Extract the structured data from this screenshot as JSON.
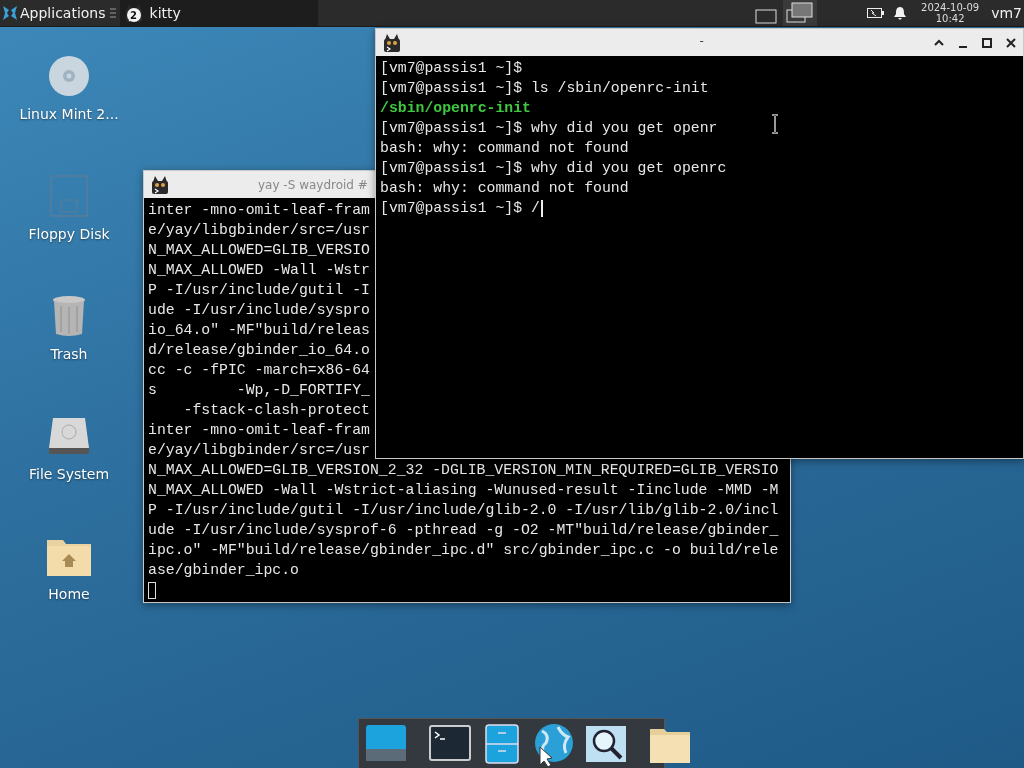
{
  "panel": {
    "menu_label": "Applications",
    "tasks": [
      {
        "label": "kitty",
        "count": "2",
        "selected": true
      }
    ],
    "workspaces": [
      {
        "selected": false
      },
      {
        "selected": true
      }
    ],
    "clock": {
      "date": "2024-10-09",
      "time": "10:42"
    },
    "user": "vm7"
  },
  "desktop_icons": [
    {
      "label": "Linux Mint 2...",
      "kind": "disc"
    },
    {
      "label": "Floppy Disk",
      "kind": "floppy"
    },
    {
      "label": "Trash",
      "kind": "trash"
    },
    {
      "label": "File System",
      "kind": "drive"
    },
    {
      "label": "Home",
      "kind": "home"
    }
  ],
  "windows": [
    {
      "title": "yay -S waydroid #",
      "cursor": {
        "kind": "block"
      },
      "lines": [
        {
          "text": "inter -mno-omit-leaf-fram",
          "kind": "output"
        },
        {
          "text": "e/yay/libgbinder/src=/usr",
          "kind": "output"
        },
        {
          "text": "N_MAX_ALLOWED=GLIB_VERSIO",
          "kind": "output"
        },
        {
          "text": "N_MAX_ALLOWED -Wall -Wstr",
          "kind": "output"
        },
        {
          "text": "P -I/usr/include/gutil -I",
          "kind": "output"
        },
        {
          "text": "ude -I/usr/include/syspro",
          "kind": "output"
        },
        {
          "text": "io_64.o\" -MF\"build/releas",
          "kind": "output"
        },
        {
          "text": "d/release/gbinder_io_64.o",
          "kind": "output"
        },
        {
          "text": "cc -c -fPIC -march=x86-64",
          "kind": "output"
        },
        {
          "text": "s         -Wp,-D_FORTIFY_",
          "kind": "output"
        },
        {
          "text": "    -fstack-clash-protect",
          "kind": "output"
        },
        {
          "text": "inter -mno-omit-leaf-fram",
          "kind": "output"
        },
        {
          "text": "e/yay/libgbinder/src=/usr",
          "kind": "output"
        },
        {
          "text": "N_MAX_ALLOWED=GLIB_VERSION_2_32 -DGLIB_VERSION_MIN_REQUIRED=GLIB_VERSIO",
          "kind": "output"
        },
        {
          "text": "N_MAX_ALLOWED -Wall -Wstrict-aliasing -Wunused-result -Iinclude -MMD -M",
          "kind": "output"
        },
        {
          "text": "P -I/usr/include/gutil -I/usr/include/glib-2.0 -I/usr/lib/glib-2.0/incl",
          "kind": "output"
        },
        {
          "text": "ude -I/usr/include/sysprof-6 -pthread -g -O2 -MT\"build/release/gbinder_",
          "kind": "output"
        },
        {
          "text": "ipc.o\" -MF\"build/release/gbinder_ipc.d\" src/gbinder_ipc.c -o build/rele",
          "kind": "output"
        },
        {
          "text": "ase/gbinder_ipc.o",
          "kind": "output"
        }
      ]
    },
    {
      "title": "-",
      "cursor": {
        "kind": "bar"
      },
      "lines": [
        {
          "text": "[vm7@passis1 ~]$",
          "kind": "output"
        },
        {
          "text": "[vm7@passis1 ~]$ ls /sbin/openrc-init",
          "kind": "output"
        },
        {
          "text": "/sbin/openrc-init",
          "kind": "path"
        },
        {
          "text": "[vm7@passis1 ~]$ why did you get openr",
          "kind": "output"
        },
        {
          "text": "bash: why: command not found",
          "kind": "output"
        },
        {
          "text": "[vm7@passis1 ~]$ why did you get openrc",
          "kind": "output"
        },
        {
          "text": "bash: why: command not found",
          "kind": "output"
        },
        {
          "text": "[vm7@passis1 ~]$ /",
          "kind": "output"
        }
      ]
    }
  ]
}
